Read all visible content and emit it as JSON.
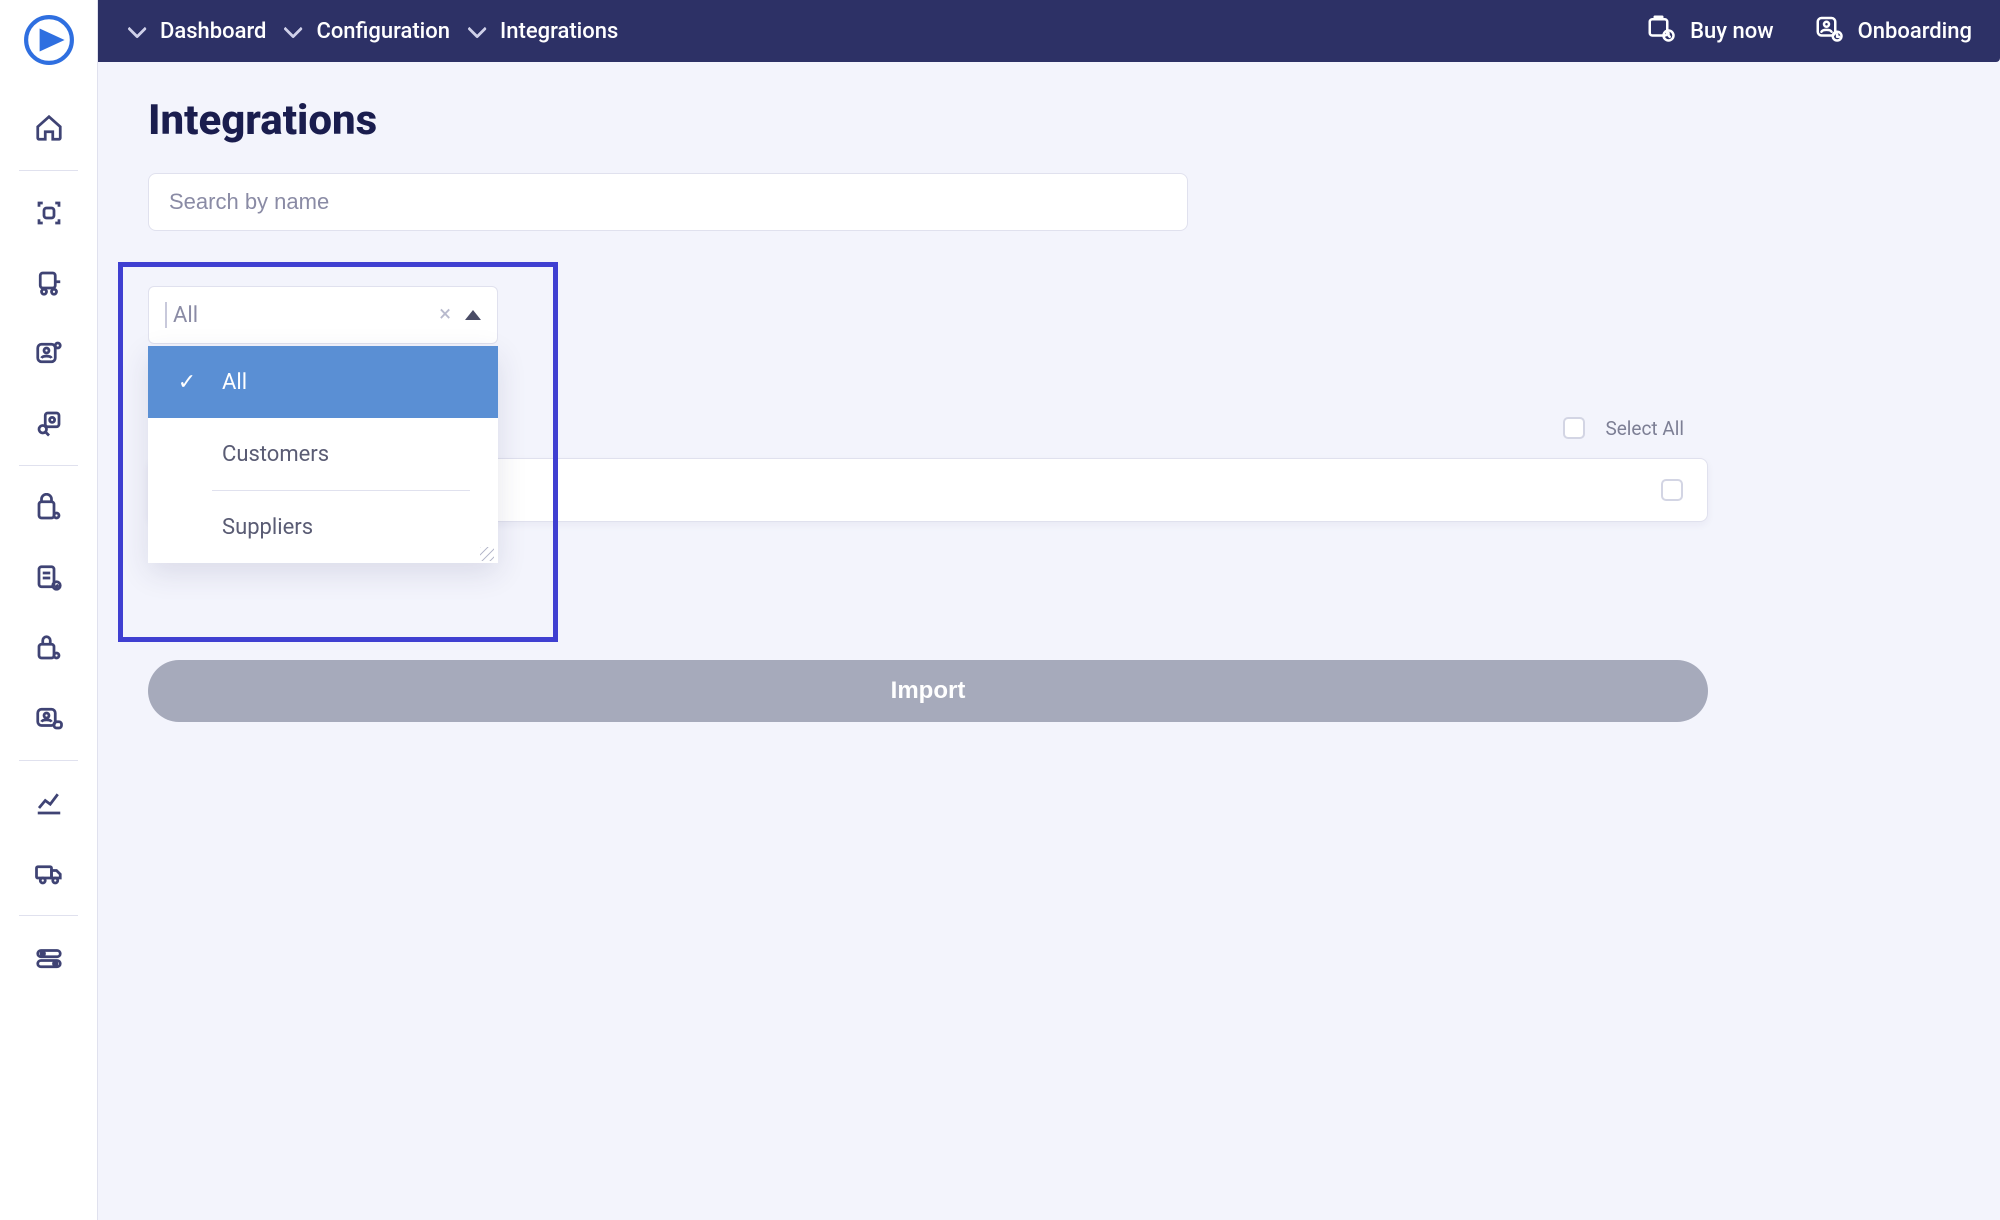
{
  "breadcrumb": {
    "items": [
      {
        "label": "Dashboard"
      },
      {
        "label": "Configuration"
      },
      {
        "label": "Integrations"
      }
    ]
  },
  "topbar": {
    "buy_label": "Buy now",
    "onboarding_label": "Onboarding"
  },
  "page": {
    "title": "Integrations"
  },
  "search": {
    "placeholder": "Search by name",
    "value": ""
  },
  "filter": {
    "placeholder": "All",
    "value": "",
    "expanded": true,
    "options": [
      {
        "label": "All",
        "selected": true
      },
      {
        "label": "Customers",
        "selected": false
      },
      {
        "label": "Suppliers",
        "selected": false
      }
    ]
  },
  "list": {
    "select_all_label": "Select All"
  },
  "actions": {
    "import_label": "Import"
  }
}
